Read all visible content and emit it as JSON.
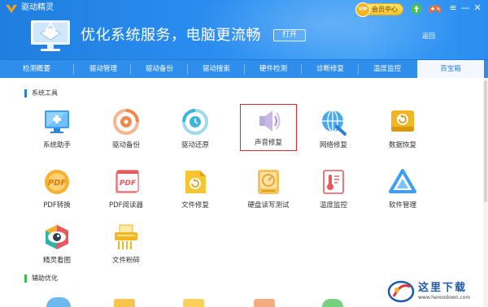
{
  "app": {
    "title": "驱动精灵"
  },
  "header": {
    "banner": "优化系统服务，电脑更流畅",
    "open_button": "打开",
    "back_link": "返回",
    "vip_badge": "VIP",
    "vip_label": "会员中心",
    "icons": [
      "logo-icon",
      "monitor-illustration-icon",
      "crown-icon",
      "gamepad-icon",
      "menu-icon",
      "minimize-icon",
      "close-icon"
    ],
    "window_controls": {
      "menu": "≡",
      "minimize": "—",
      "close": "✕"
    }
  },
  "tabs": [
    "检测概要",
    "驱动管理",
    "驱动备份",
    "驱动搜索",
    "硬件检测",
    "诊断修复",
    "温度监控",
    "百宝箱"
  ],
  "active_tab": "百宝箱",
  "sections": [
    {
      "title": "系统工具",
      "items": [
        {
          "label": "系统助手",
          "icon": "system-assistant-icon"
        },
        {
          "label": "驱动备份",
          "icon": "driver-backup-icon"
        },
        {
          "label": "驱动还原",
          "icon": "driver-restore-icon"
        },
        {
          "label": "声音修复",
          "icon": "sound-repair-icon",
          "selected": true
        },
        {
          "label": "网络修复",
          "icon": "network-repair-icon"
        },
        {
          "label": "数据恢复",
          "icon": "data-recovery-icon"
        },
        {
          "label": "PDF转换",
          "icon": "pdf-convert-icon"
        },
        {
          "label": "PDF阅读器",
          "icon": "pdf-reader-icon"
        },
        {
          "label": "文件修复",
          "icon": "file-repair-icon"
        },
        {
          "label": "硬盘读写测试",
          "icon": "disk-test-icon"
        },
        {
          "label": "温度监控",
          "icon": "temperature-icon"
        },
        {
          "label": "软件管理",
          "icon": "software-manager-icon"
        },
        {
          "label": "精灵看图",
          "icon": "image-viewer-icon"
        },
        {
          "label": "文件粉碎",
          "icon": "file-shredder-icon"
        }
      ]
    },
    {
      "title": "辅助优化",
      "items": []
    }
  ],
  "watermark": {
    "text": "这里下载",
    "url": "www.hereodown.com"
  },
  "colors": {
    "header_blue": "#2a8df0",
    "tab_bar": "#2f8eec",
    "active_tab_text": "#2b7fdc",
    "section_blue": "#2b7fdc",
    "section_green": "#3bbd4a",
    "selected_border": "#e0242a"
  }
}
